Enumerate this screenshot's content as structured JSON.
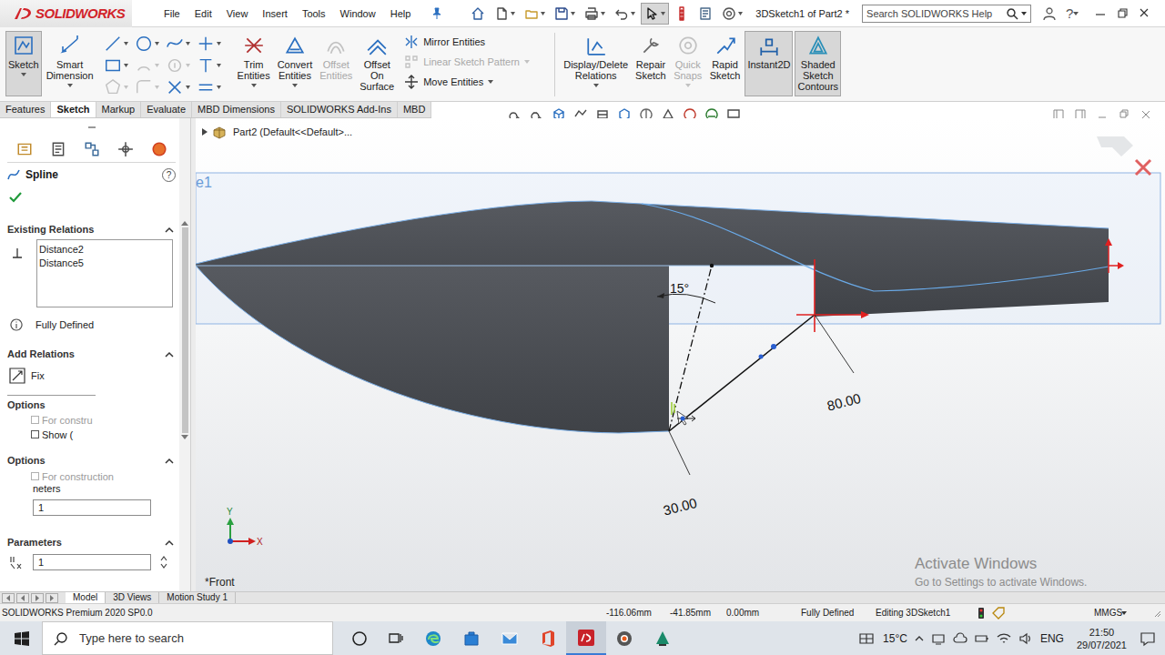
{
  "app": {
    "logo": "SOLIDWORKS",
    "title": "3DSketch1 of Part2 *",
    "help": "?"
  },
  "menu": [
    "File",
    "Edit",
    "View",
    "Insert",
    "Tools",
    "Window",
    "Help"
  ],
  "quick_tools": [
    {
      "selected": false
    },
    {
      "selected": false
    },
    {
      "selected": false
    },
    {
      "selected": false
    },
    {
      "selected": false
    },
    {
      "selected": false
    },
    {
      "selected": true
    },
    {
      "selected": false
    },
    {
      "selected": false
    },
    {
      "selected": false
    }
  ],
  "search": {
    "placeholder": "Search SOLIDWORKS Help"
  },
  "commands": {
    "left": [
      {
        "label": "Sketch",
        "selected": true,
        "disabled": false,
        "dropdown": true
      },
      {
        "label": "Smart Dimension",
        "selected": false,
        "disabled": false,
        "dropdown": true
      }
    ],
    "sketch_tools": [
      {
        "disabled": false
      },
      {
        "disabled": false
      },
      {
        "disabled": false
      },
      {
        "disabled": false
      },
      {
        "disabled": false
      },
      {
        "disabled": true
      },
      {
        "disabled": true
      },
      {
        "disabled": false
      },
      {
        "disabled": true
      },
      {
        "disabled": true
      },
      {
        "disabled": false
      },
      {
        "disabled": false
      }
    ],
    "mid": [
      {
        "label": "Trim Entities",
        "selected": false,
        "disabled": false,
        "dropdown": true
      },
      {
        "label": "Convert Entities",
        "selected": false,
        "disabled": false,
        "dropdown": true
      },
      {
        "label": "Offset Entities",
        "selected": false,
        "disabled": true,
        "dropdown": false
      },
      {
        "label": "Offset On Surface",
        "selected": false,
        "disabled": false,
        "dropdown": false
      }
    ],
    "list": [
      {
        "label": "Mirror Entities",
        "disabled": false,
        "dropdown": false
      },
      {
        "label": "Linear Sketch Pattern",
        "disabled": true,
        "dropdown": true
      },
      {
        "label": "Move Entities",
        "disabled": false,
        "dropdown": true
      }
    ],
    "right": [
      {
        "label": "Display/Delete Relations",
        "selected": false,
        "disabled": false,
        "dropdown": true
      },
      {
        "label": "Repair Sketch",
        "selected": false,
        "disabled": false,
        "dropdown": false
      },
      {
        "label": "Quick Snaps",
        "selected": false,
        "disabled": true,
        "dropdown": true
      },
      {
        "label": "Rapid Sketch",
        "selected": false,
        "disabled": false,
        "dropdown": false
      },
      {
        "label": "Instant2D",
        "selected": true,
        "disabled": false,
        "dropdown": false
      },
      {
        "label": "Shaded Sketch Contours",
        "selected": true,
        "disabled": false,
        "dropdown": false
      }
    ]
  },
  "tabs": [
    {
      "label": "Features",
      "selected": false
    },
    {
      "label": "Sketch",
      "selected": true
    },
    {
      "label": "Markup",
      "selected": false
    },
    {
      "label": "Evaluate",
      "selected": false
    },
    {
      "label": "MBD Dimensions",
      "selected": false
    },
    {
      "label": "SOLIDWORKS Add-Ins",
      "selected": false
    },
    {
      "label": "MBD",
      "selected": false
    }
  ],
  "property_manager": {
    "title": "Spline",
    "help": "?",
    "existing_relations": {
      "header": "Existing Relations",
      "expanded": true,
      "items": [
        "Distance2",
        "Distance5"
      ]
    },
    "status": "Fully Defined",
    "add_relations": {
      "header": "Add Relations",
      "expanded": true,
      "items": [
        "Fix"
      ]
    },
    "options_ghost": {
      "header": "Options",
      "items": [
        {
          "label": "For constru",
          "checked": false,
          "disabled": true
        },
        {
          "label": "Show (",
          "checked": false,
          "disabled": false
        }
      ]
    },
    "options": {
      "header": "Options",
      "expanded": true,
      "items": [
        {
          "label": "For construction",
          "checked": false,
          "disabled": true
        }
      ],
      "field_label": "neters",
      "field_value": "1"
    },
    "parameters": {
      "header": "Parameters",
      "expanded": true,
      "field_value": "1"
    }
  },
  "viewport": {
    "tree": "Part2  (Default<<Default>...",
    "plane_label": "e1",
    "view_label": "*Front",
    "dimensions": [
      {
        "text": "15°"
      },
      {
        "text": "80.00"
      },
      {
        "text": "30.00"
      }
    ],
    "axes": {
      "y": "Y",
      "x": "X"
    },
    "watermark": {
      "title": "Activate Windows",
      "subtitle": "Go to Settings to activate Windows."
    }
  },
  "bottom_tabs": [
    {
      "label": "Model",
      "selected": true
    },
    {
      "label": "3D Views",
      "selected": false
    },
    {
      "label": "Motion Study 1",
      "selected": false
    }
  ],
  "status_bar": {
    "product": "SOLIDWORKS Premium 2020 SP0.0",
    "x": "-116.06mm",
    "y": "-41.85mm",
    "z": "0.00mm",
    "state": "Fully Defined",
    "editing": "Editing 3DSketch1",
    "units": "MMGS"
  },
  "taskbar": {
    "search": "Type here to search",
    "weather": "15°C",
    "language": "ENG",
    "time": "21:50",
    "date": "29/07/2021"
  }
}
